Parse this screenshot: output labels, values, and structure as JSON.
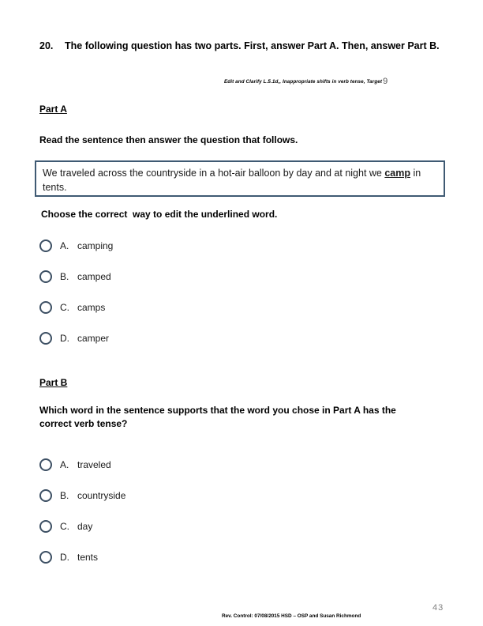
{
  "question": {
    "number": "20.",
    "stem": "The following question has two parts. First, answer Part A. Then, answer Part B.",
    "standard_label": "Edit and Clarify L.5.1d,, Inappropriate shifts in verb tense, Target",
    "target_number": "9"
  },
  "part_a": {
    "heading": "Part A",
    "read_prompt": "Read the sentence then answer the question that follows.",
    "sentence": {
      "before": "We traveled across the countryside in a hot-air balloon by day and at night we ",
      "underlined": "camp",
      "after": " in tents."
    },
    "choose_prompt": "Choose the correct  way to edit the underlined word.",
    "options": [
      {
        "letter": "A.",
        "text": "camping"
      },
      {
        "letter": "B.",
        "text": "camped"
      },
      {
        "letter": "C.",
        "text": "camps"
      },
      {
        "letter": "D.",
        "text": "camper"
      }
    ]
  },
  "part_b": {
    "heading": "Part B",
    "prompt": "Which word in the sentence supports that the word you chose in Part A has the correct verb tense?",
    "options": [
      {
        "letter": "A.",
        "text": "traveled"
      },
      {
        "letter": "B.",
        "text": "countryside"
      },
      {
        "letter": "C.",
        "text": "day"
      },
      {
        "letter": "D.",
        "text": "tents"
      }
    ]
  },
  "footer": {
    "revision_note": "Rev. Control: 07/08/2015  HSD – OSP and Susan Richmond",
    "page_number": "43"
  },
  "colors": {
    "sentence_box_border": "#3f5a73",
    "radio_outline": "#3c4f63",
    "page_number": "#808080"
  }
}
